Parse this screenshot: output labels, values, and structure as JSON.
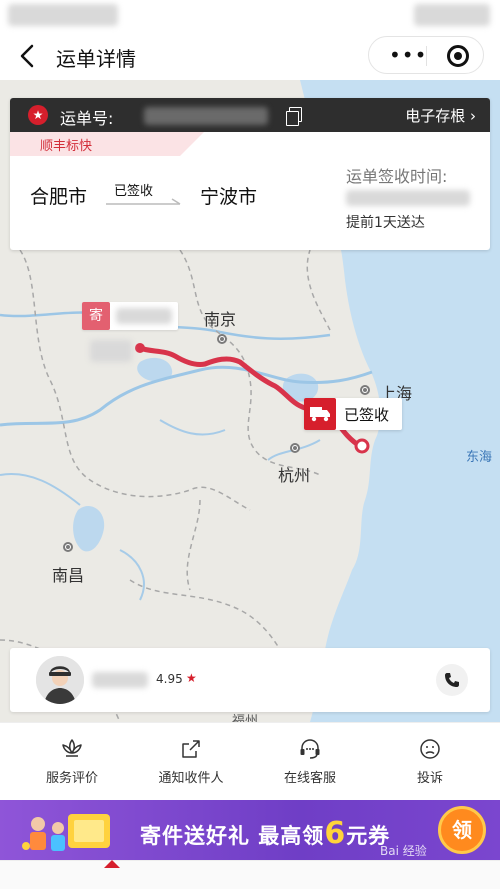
{
  "header": {
    "title": "运单详情"
  },
  "waybill": {
    "number_label": "运单号:",
    "eslip_label": "电子存根 ›",
    "service": "顺丰标快",
    "from_city": "合肥市",
    "to_city": "宁波市",
    "status": "已签收",
    "signed_time_label": "运单签收时间:",
    "ahead_note": "提前1天送达"
  },
  "map": {
    "cities": {
      "nanjing": "南京",
      "shanghai": "上海",
      "hangzhou": "杭州",
      "nanchang": "南昌"
    },
    "sea": "东海",
    "send_tag": "寄",
    "signed_badge": "已签收",
    "partial_label": "福州"
  },
  "courier": {
    "rating": "4.95",
    "star": "★"
  },
  "actions": [
    {
      "label": "服务评价",
      "icon": "lotus-icon"
    },
    {
      "label": "通知收件人",
      "icon": "share-icon"
    },
    {
      "label": "在线客服",
      "icon": "headset-icon"
    },
    {
      "label": "投诉",
      "icon": "sad-face-icon"
    }
  ],
  "banner": {
    "text_a": "寄件送好礼 最高领",
    "text_num": "6",
    "text_b": "元券",
    "cta": "领"
  },
  "watermark": "Bai 经验 jingyan.baidu.com"
}
